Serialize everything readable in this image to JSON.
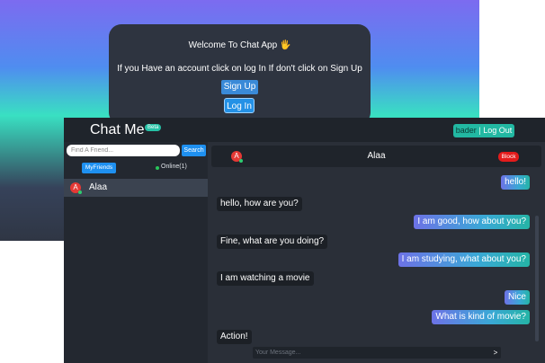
{
  "welcome": {
    "title": "Welcome To Chat App 🖐",
    "text": "If you Have an account click on log In If don't click on Sign Up",
    "signup_label": "Sign Up",
    "login_label": "Log In"
  },
  "app": {
    "brand": "Chat Me",
    "beta": "Beta",
    "user": "bader",
    "separator": "|",
    "logout_label": "Log Out"
  },
  "sidebar": {
    "search_placeholder": "Find A Friend...",
    "search_label": "Search",
    "myfriends_label": "MyFriends",
    "online_label": "Online(1)",
    "friends": [
      {
        "initial": "A",
        "name": "Alaa"
      }
    ]
  },
  "conversation": {
    "header_initial": "A",
    "name": "Alaa",
    "block_label": "Block",
    "messages": [
      {
        "dir": "out",
        "text": "hello!"
      },
      {
        "dir": "in",
        "text": "hello, how are you?"
      },
      {
        "dir": "out",
        "text": "I am good, how about you?"
      },
      {
        "dir": "in",
        "text": "Fine, what are you doing?"
      },
      {
        "dir": "out",
        "text": "I am studying, what about you?"
      },
      {
        "dir": "in",
        "text": "I am watching a movie"
      },
      {
        "dir": "out",
        "text": "Nice"
      },
      {
        "dir": "out",
        "text": "What is kind of movie?"
      },
      {
        "dir": "in",
        "text": "Action!"
      }
    ],
    "composer_placeholder": "Your Message...",
    "send_label": ">"
  },
  "colors": {
    "accent": "#1e90f0",
    "teal": "#26c2a6",
    "danger": "#e31b1b",
    "online": "#29c55a"
  }
}
